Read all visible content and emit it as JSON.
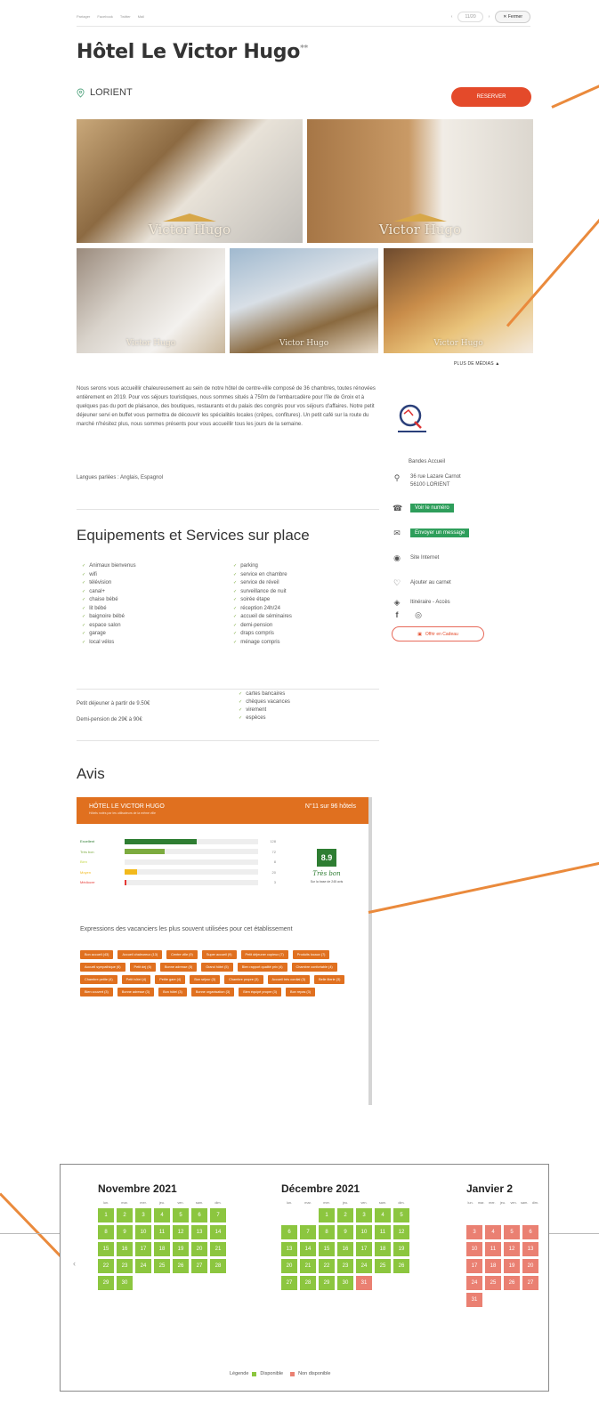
{
  "topbar": {
    "share": [
      "Partager",
      "Facebook",
      "Twitter",
      "Mail"
    ],
    "counter": "11/20",
    "close_label": "Fermer"
  },
  "hotel": {
    "name": "Hôtel Le Victor Hugo",
    "stars": "**",
    "city": "LORIENT",
    "reserve_label": "RESERVER",
    "more_media": "PLUS DE MÉDIAS",
    "watermark": "Victor Hugo"
  },
  "description": {
    "text": "Nous serons vous accueillir chaleureusement au sein de notre hôtel de centre-ville composé de 36 chambres, toutes rénovées entièrement en 2019. Pour vos séjours touristiques, nous sommes situés à 750m de l'embarcadère pour l'île de Groix et à quelques pas du port de plaisance, des boutiques, restaurants et du palais des congrès pour vos séjours d'affaires. Notre petit déjeuner servi en buffet vous permettra de découvrir les spécialités locales (crêpes, confitures). Un petit café sur la route du marché n'hésitez plus, nous sommes présents pour vous accueillir tous les jours de la semaine.",
    "languages": "Langues parlées : Anglais, Espagnol"
  },
  "contact": {
    "desk": "Bandes Accueil",
    "address1": "36 rue Lazare Carnot",
    "address2": "56100 LORIENT",
    "phone_btn": "Voir le numéro",
    "message_btn": "Envoyer un message",
    "website": "Site Internet",
    "add_carnet": "Ajouter au carnet",
    "itinerary": "Itinéraire - Accès",
    "gift_btn": "Offrir en Cadeau"
  },
  "equipments": {
    "title": "Equipements et Services sur place",
    "col1": [
      "Animaux bienvenus",
      "wifi",
      "télévision",
      "canal+",
      "chaise bébé",
      "lit bébé",
      "baignoire bébé",
      "espace salon",
      "garage",
      "local vélos"
    ],
    "col2": [
      "parking",
      "service en chambre",
      "service de réveil",
      "surveillance de nuit",
      "soirée étape",
      "réception 24h/24",
      "accueil de séminaires",
      "demi-pension",
      "draps compris",
      "ménage compris"
    ],
    "col2_extra": [
      "cartes bancaires",
      "chèques vacances",
      "virement",
      "espèces"
    ],
    "price1": "Petit déjeuner à partir de 9.50€",
    "price2": "Demi-pension de 29€ à 90€"
  },
  "reviews": {
    "title": "Avis",
    "hotel_label": "HÔTEL LE VICTOR HUGO",
    "hotel_sub": "Hôtels notés par les utilisateurs de la même ville",
    "rank": "N°11 sur 96 hôtels",
    "rows": [
      {
        "label": "Excellent",
        "pct": 0.54,
        "count": "128",
        "color": "#2e7d32"
      },
      {
        "label": "Très bon",
        "pct": 0.3,
        "count": "72",
        "color": "#7cab3f"
      },
      {
        "label": "Bien",
        "pct": 0.0,
        "count": "8",
        "color": "#c6d94e"
      },
      {
        "label": "Moyen",
        "pct": 0.09,
        "count": "20",
        "color": "#f2b91b"
      },
      {
        "label": "Médiocre",
        "pct": 0.01,
        "count": "3",
        "color": "#e53935"
      }
    ],
    "score": "8.9",
    "score_label": "Très bon",
    "score_note": "Sur la base de 245 avis",
    "expr_title": "Expressions des vacanciers les plus souvent utilisées pour cet établissement",
    "tags": [
      "Bon accueil (43)",
      "Accueil chaleureux (13)",
      "Centre ville (9)",
      "Super accueil (9)",
      "Petit déjeuner copieux (7)",
      "Produits locaux (7)",
      "Accueil sympathique (6)",
      "Petit dej (6)",
      "Bonne adresse (5)",
      "Grand hôtel (5)",
      "Bien rapport qualité prix (4)",
      "Chambre confortable (4)",
      "Chambre petite (4)",
      "Petit hôtel (4)",
      "Petite gare (4)",
      "Bon séjour (3)",
      "Chambre propre (3)",
      "Accueil très cordial (3)",
      "Belle literie (3)",
      "Bien couvert (3)",
      "Bonne adresse (3)",
      "Bon hôtel (3)",
      "Bonne organisation (3)",
      "Bien équipé propre (3)",
      "Bon repas (3)"
    ]
  },
  "calendar": {
    "months": [
      {
        "name": "Novembre 2021",
        "offset": 0,
        "days": 30,
        "unavailable": []
      },
      {
        "name": "Décembre 2021",
        "offset": 2,
        "days": 31,
        "unavailable": [
          31
        ]
      },
      {
        "name": "Janvier 2",
        "offset": 5,
        "days": 31,
        "unavailable": [
          1,
          2,
          3,
          4,
          5,
          6,
          7,
          8,
          9,
          10,
          11,
          12,
          13,
          14,
          15,
          16,
          17,
          18,
          19,
          20,
          21,
          22,
          23,
          24,
          25,
          26,
          27,
          28,
          29,
          30,
          31
        ]
      }
    ],
    "dow": [
      "lun.",
      "mar.",
      "mer.",
      "jeu.",
      "ven.",
      "sam.",
      "dim."
    ],
    "legend_title": "Légende",
    "legend_available": "Disponible",
    "legend_unavailable": "Non disponible",
    "colors": {
      "available": "#8cc63f",
      "unavailable": "#ea8072"
    }
  }
}
